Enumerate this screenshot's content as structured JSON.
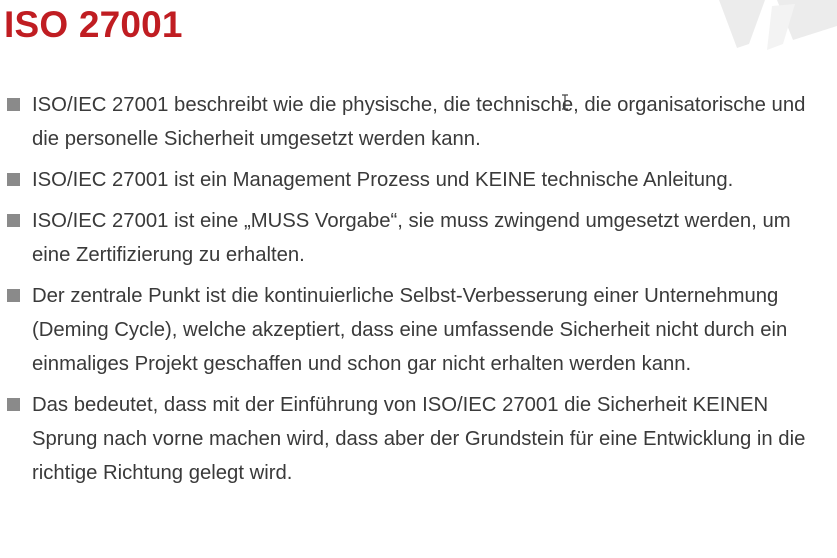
{
  "slide": {
    "title": "ISO 27001",
    "bullets": [
      "ISO/IEC 27001 beschreibt wie die physische, die technische, die organisatorische und die personelle Sicherheit umgesetzt werden kann.",
      "ISO/IEC 27001 ist ein Management Prozess und KEINE technische Anleitung.",
      "ISO/IEC 27001 ist eine „MUSS Vorgabe“, sie muss zwingend umgesetzt werden, um eine Zertifizierung zu erhalten.",
      "Der zentrale Punkt ist die kontinuierliche Selbst-Verbesserung einer Unternehmung (Deming Cycle), welche akzeptiert, dass eine umfassende Sicherheit nicht durch ein einmaliges Projekt geschaffen und schon gar nicht erhalten werden kann.",
      "Das bedeutet, dass mit der Einführung von ISO/IEC 27001 die Sicherheit KEINEN Sprung nach vorne machen wird, dass aber der Grundstein für eine Entwicklung in die richtige Richtung gelegt wird."
    ]
  },
  "colors": {
    "title": "#c01d22",
    "text": "#3a3a3a",
    "bullet_marker": "#8a8a8a",
    "decoration": "#ececec"
  },
  "icons": {
    "bullet_marker": "square-bullet-icon",
    "cursor": "text-cursor-icon"
  }
}
